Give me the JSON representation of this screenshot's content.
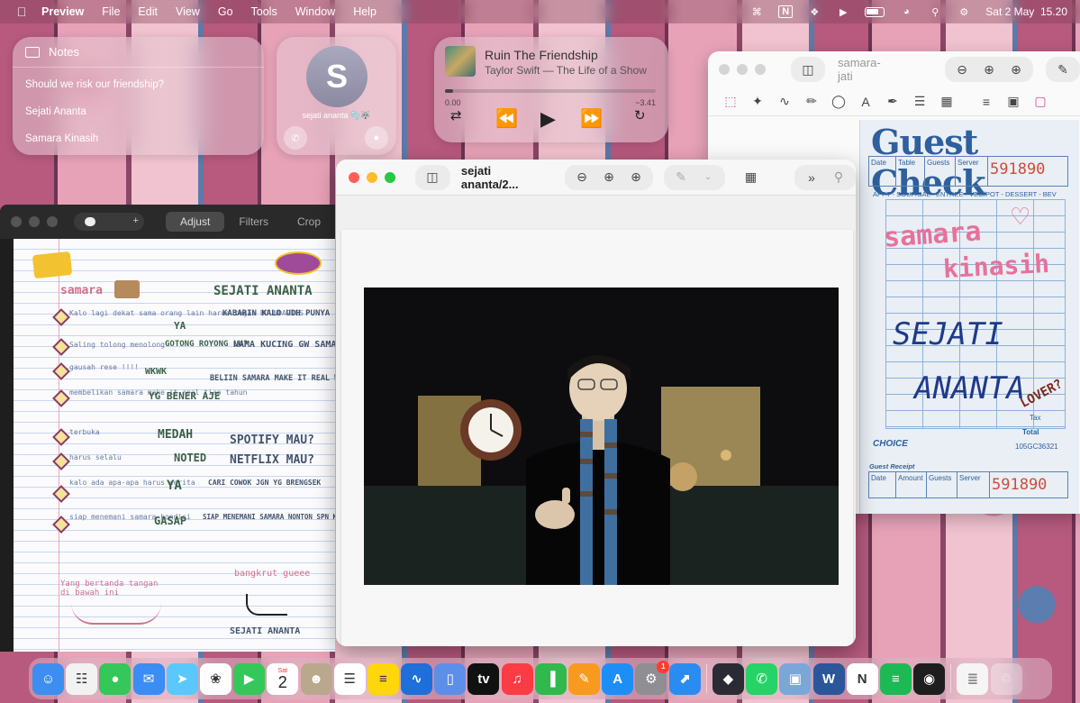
{
  "menubar": {
    "app_name": "Preview",
    "menus": [
      "File",
      "Edit",
      "View",
      "Go",
      "Tools",
      "Window",
      "Help"
    ],
    "datetime": "Sat 2 May  15.20"
  },
  "notes_widget": {
    "title": "Notes",
    "items": [
      "Should we risk our friendship?",
      "Sejati Ananta",
      "Samara Kinasih"
    ]
  },
  "contact_widget": {
    "initial": "S",
    "name": "sejati ananta 🫧🐺"
  },
  "music_widget": {
    "song": "Ruin The Friendship",
    "artist_album": "Taylor Swift — The Life of a Show",
    "elapsed": "0.00",
    "remaining": "~3.41",
    "progress": 0.04
  },
  "edit_window": {
    "tabs": [
      "Adjust",
      "Filters",
      "Crop"
    ],
    "active_tab": "Adjust",
    "zoom_plus": "+",
    "notebook": {
      "left_name": "samara",
      "right_name": "SEJATI ANANTA",
      "lines_left": [
        "Kalo lagi dekat sama orang lain harus tegas BOUNDARIES",
        "Saling tolong menolong",
        "gausah rese !!!!",
        "membelikan samara make it real tiap tahun",
        "terbuka",
        "harus selalu",
        "kalo ada apa-apa harus cerita",
        "siap menemani samara kondisi"
      ],
      "lines_right": [
        "KABARIN KALO UDH PUNYA PACAR",
        "NAMA KUCING GW SAMARA",
        "BELIIN SAMARA MAKE IT REAL WAKTU DIA UMUR 3 TAHUN",
        "SPOTIFY MAU?",
        "NETFLIX MAU?",
        "CARI COWOK JGN YG BRENGSEK",
        "SIAP MENEMANI SAMARA NONTON SPN KLO DIBELIIN LEGO"
      ],
      "replies": [
        "YA",
        "GOTONG ROYONG LU?",
        "WKWK",
        "YG BENER AJE",
        "MEDAH",
        "NOTED",
        "YA",
        "GASAP"
      ],
      "footer_left": "Yang bertanda tangan di bawah ini",
      "footer_right": "SEJATI ANANTA",
      "bangkrut": "bangkrut gueee"
    }
  },
  "preview_window": {
    "title": "sejati ananta/2..."
  },
  "check_window": {
    "title": "samara-jati",
    "heading": "Guest Check",
    "columns": [
      "Date",
      "Table",
      "Guests",
      "Server"
    ],
    "number": "591890",
    "categories": "APPT - SOUP/SAL - ENTREE - VEG/POT - DESSERT - BEV",
    "handwriting_pink": [
      "samara",
      "kinasih"
    ],
    "handwriting_blue": [
      "SEJATI",
      "ANANTA"
    ],
    "handwriting_lover": "LOVER?",
    "tax_label": "Tax",
    "total_label": "Total",
    "brand": "CHOICE",
    "code": "105GC36321",
    "receipt_label": "Guest Receipt",
    "receipt_columns": [
      "Date",
      "Amount",
      "Guests",
      "Server"
    ],
    "receipt_number": "591890"
  },
  "dock": {
    "apps": [
      {
        "name": "finder-icon",
        "color": "#3d8ef0",
        "glyph": "☺"
      },
      {
        "name": "launchpad-icon",
        "color": "#f2f2f2",
        "glyph": "☷"
      },
      {
        "name": "messages-icon",
        "color": "#34c759",
        "glyph": "●"
      },
      {
        "name": "mail-icon",
        "color": "#3b8cf5",
        "glyph": "✉"
      },
      {
        "name": "maps-icon",
        "color": "#5ac8fa",
        "glyph": "➤"
      },
      {
        "name": "photos-icon",
        "color": "#ffffff",
        "glyph": "❀"
      },
      {
        "name": "facetime-icon",
        "color": "#34c759",
        "glyph": "▶"
      },
      {
        "name": "calendar-icon",
        "color": "#ffffff",
        "glyph": "2"
      },
      {
        "name": "contacts-icon",
        "color": "#b9a88c",
        "glyph": "☻"
      },
      {
        "name": "reminders-icon",
        "color": "#ffffff",
        "glyph": "☰"
      },
      {
        "name": "notes-icon",
        "color": "#ffd60a",
        "glyph": "≡"
      },
      {
        "name": "freeform-icon",
        "color": "#1e6fd9",
        "glyph": "∿"
      },
      {
        "name": "iphone-mirroring-icon",
        "color": "#5e8fe8",
        "glyph": "▯"
      },
      {
        "name": "tv-icon",
        "color": "#111111",
        "glyph": "tv"
      },
      {
        "name": "music-icon",
        "color": "#fc3c44",
        "glyph": "♫"
      },
      {
        "name": "numbers-icon",
        "color": "#30b94d",
        "glyph": "▐"
      },
      {
        "name": "pages-icon",
        "color": "#f79a1e",
        "glyph": "✎"
      },
      {
        "name": "app-store-icon",
        "color": "#1e8ef7",
        "glyph": "A"
      },
      {
        "name": "system-settings-icon",
        "color": "#8e8e93",
        "glyph": "⚙"
      },
      {
        "name": "safari-icon",
        "color": "#2a8cf0",
        "glyph": "⬈"
      },
      {
        "name": "setapp-icon",
        "color": "#2b2b35",
        "glyph": "◆"
      },
      {
        "name": "whatsapp-icon",
        "color": "#25d366",
        "glyph": "✆"
      },
      {
        "name": "preview-icon",
        "color": "#7aa7d8",
        "glyph": "▣"
      },
      {
        "name": "word-icon",
        "color": "#2b579a",
        "glyph": "W"
      },
      {
        "name": "notion-icon",
        "color": "#ffffff",
        "glyph": "N"
      },
      {
        "name": "spotify-icon",
        "color": "#1db954",
        "glyph": "≡"
      },
      {
        "name": "figma-icon",
        "color": "#1e1e1e",
        "glyph": "◉"
      }
    ],
    "settings_badge": "1",
    "calendar_day": "Sat",
    "calendar_date": "2"
  }
}
